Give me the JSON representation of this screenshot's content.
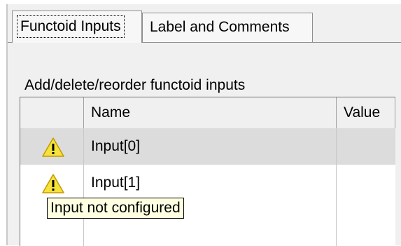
{
  "tabs": [
    {
      "label": "Functoid Inputs",
      "active": true
    },
    {
      "label": "Label and Comments",
      "active": false
    }
  ],
  "panel": {
    "title": "Add/delete/reorder functoid inputs"
  },
  "grid": {
    "columns": {
      "name": "Name",
      "value": "Value"
    },
    "rows": [
      {
        "name": "Input[0]",
        "value": "",
        "icon": "warning-icon",
        "selected": true
      },
      {
        "name": "Input[1]",
        "value": "",
        "icon": "warning-icon",
        "selected": false
      }
    ]
  },
  "tooltip": {
    "text": "Input not configured"
  },
  "colors": {
    "warning_fill": "#f5e23a",
    "tooltip_bg": "#ffffe1",
    "selected_row": "#dcdcdc"
  }
}
